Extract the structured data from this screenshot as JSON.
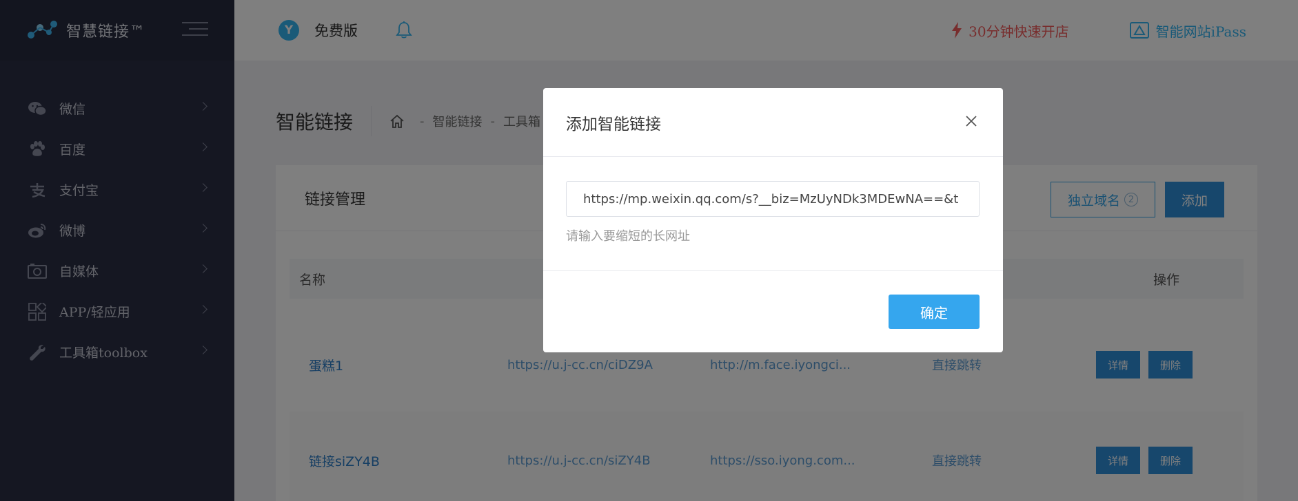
{
  "brand": {
    "title": "智慧链接™"
  },
  "sidebar": {
    "items": [
      {
        "label": "微信",
        "icon": "wechat-icon"
      },
      {
        "label": "百度",
        "icon": "paw-icon"
      },
      {
        "label": "支付宝",
        "icon": "alipay-icon"
      },
      {
        "label": "微博",
        "icon": "weibo-icon"
      },
      {
        "label": "自媒体",
        "icon": "camera-icon"
      },
      {
        "label": "APP/轻应用",
        "icon": "apps-grid-icon"
      },
      {
        "label": "工具箱toolbox",
        "icon": "wrench-icon"
      }
    ]
  },
  "topbar": {
    "plan_icon_text": "Y",
    "plan_label": "免费版",
    "quick_label": "30分钟快速开店",
    "ipass_label": "智能网站iPass",
    "colors": {
      "quick": "#f05a5a",
      "ipass": "#35b5f0"
    }
  },
  "page": {
    "title": "智能链接",
    "breadcrumb": [
      "智能链接",
      "工具箱"
    ]
  },
  "card": {
    "title": "链接管理",
    "domain_button": "独立域名",
    "domain_count": "2",
    "add_button": "添加"
  },
  "table": {
    "headers": {
      "name": "名称",
      "op": "操作"
    },
    "rows": [
      {
        "name": "蛋糕1",
        "short": "https://u.j-cc.cn/ciDZ9A",
        "long": "http://m.face.iyongci...",
        "mode": "直接跳转",
        "detail": "详情",
        "delete": "删除"
      },
      {
        "name": "链接siZY4B",
        "short": "https://u.j-cc.cn/siZY4B",
        "long": "https://sso.iyong.com...",
        "mode": "直接跳转",
        "detail": "详情",
        "delete": "删除"
      }
    ]
  },
  "modal": {
    "title": "添加智能链接",
    "url_value": "https://mp.weixin.qq.com/s?__biz=MzUyNDk3MDEwNA==&t",
    "hint": "请输入要缩短的长网址",
    "confirm": "确定"
  }
}
